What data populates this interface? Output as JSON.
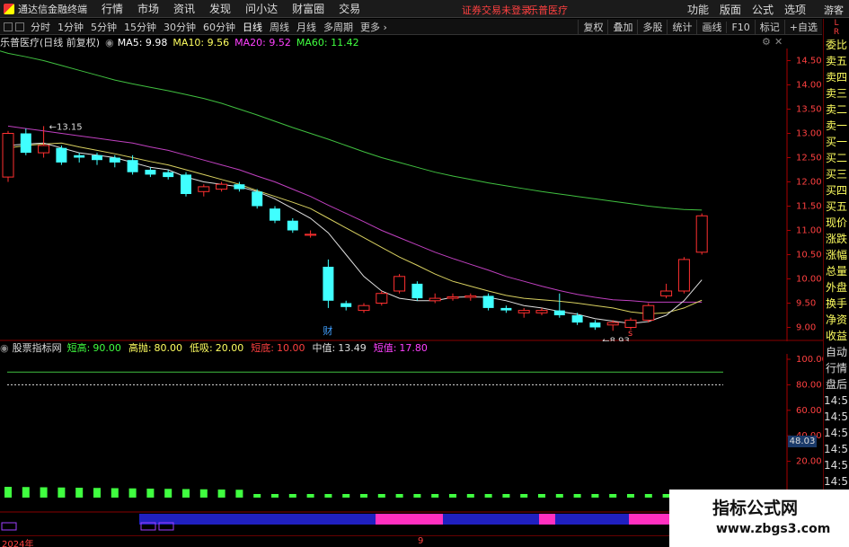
{
  "menubar": {
    "app_title": "通达信金融终端",
    "items": [
      "行情",
      "市场",
      "资讯",
      "发现",
      "问小达",
      "财富圈",
      "交易"
    ],
    "login_warning": "证券交易未登录",
    "stock_link": "乐普医疗",
    "right_items": [
      "功能",
      "版面",
      "公式",
      "选项"
    ],
    "guest": "游客"
  },
  "toolbar": {
    "periods": [
      "分时",
      "1分钟",
      "5分钟",
      "15分钟",
      "30分钟",
      "60分钟",
      "日线",
      "周线",
      "月线",
      "多周期",
      "更多"
    ],
    "active": "日线",
    "right_buttons": [
      "复权",
      "叠加",
      "多股",
      "统计",
      "画线",
      "F10",
      "标记",
      "+自选"
    ]
  },
  "header": {
    "stock_name": "乐普医疗(日线 前复权)",
    "ma5": "MA5: 9.98",
    "ma10": "MA10: 9.56",
    "ma20": "MA20: 9.52",
    "ma60": "MA60: 11.42"
  },
  "right_column": {
    "top": "L\nR",
    "labels": [
      "委比",
      "卖五",
      "卖四",
      "卖三",
      "卖二",
      "卖一",
      "买一",
      "买二",
      "买三",
      "买四",
      "买五",
      "现价",
      "涨跌",
      "涨幅",
      "总量",
      "外盘",
      "换手",
      "净资",
      "收益",
      "自动",
      "行情",
      "盘后",
      "14:5(",
      "14:5(",
      "14:5(",
      "14:5(",
      "14:5(",
      "14:5(",
      "14:5(",
      "14:5("
    ]
  },
  "price_axis": {
    "ticks": [
      "14.50",
      "14.00",
      "13.50",
      "13.00",
      "12.50",
      "12.00",
      "11.50",
      "11.00",
      "10.50",
      "10.00",
      "9.50",
      "9.00"
    ]
  },
  "indicator": {
    "name": "股票指标网",
    "items": [
      {
        "label": "短高:",
        "value": "90.00",
        "color": "#40ff40"
      },
      {
        "label": "高抛:",
        "value": "80.00",
        "color": "#ffff60"
      },
      {
        "label": "低吸:",
        "value": "20.00",
        "color": "#ffff60"
      },
      {
        "label": "短底:",
        "value": "10.00",
        "color": "#ff4040"
      },
      {
        "label": "中值:",
        "value": "13.49",
        "color": "#dddddd"
      },
      {
        "label": "短值:",
        "value": "17.80",
        "color": "#ff40ff"
      }
    ],
    "axis_ticks": [
      "100.00",
      "80.00",
      "60.00",
      "40.00",
      "20.00"
    ],
    "current_value": "48.03"
  },
  "date_axis": {
    "labels": [
      "2024年",
      "9"
    ]
  },
  "annotations": {
    "high_label": "13.15",
    "low_label": "8.93",
    "fin_marker": "财",
    "s_marker": "s"
  },
  "watermark": {
    "line1": "指标公式网",
    "line2": "www.zbgs3.com"
  },
  "chart_data": {
    "type": "candlestick",
    "ylim": [
      8.75,
      14.75
    ],
    "candles": [
      {
        "o": 12.1,
        "c": 13.0,
        "h": 13.05,
        "l": 12.0
      },
      {
        "o": 13.0,
        "c": 12.6,
        "h": 13.1,
        "l": 12.55
      },
      {
        "o": 12.6,
        "c": 12.75,
        "h": 13.15,
        "l": 12.5
      },
      {
        "o": 12.7,
        "c": 12.4,
        "h": 12.75,
        "l": 12.35
      },
      {
        "o": 12.55,
        "c": 12.5,
        "h": 12.6,
        "l": 12.4
      },
      {
        "o": 12.55,
        "c": 12.45,
        "h": 12.6,
        "l": 12.35
      },
      {
        "o": 12.5,
        "c": 12.4,
        "h": 12.55,
        "l": 12.3
      },
      {
        "o": 12.45,
        "c": 12.2,
        "h": 12.55,
        "l": 12.15
      },
      {
        "o": 12.25,
        "c": 12.15,
        "h": 12.3,
        "l": 12.1
      },
      {
        "o": 12.2,
        "c": 12.1,
        "h": 12.25,
        "l": 12.05
      },
      {
        "o": 12.15,
        "c": 11.75,
        "h": 12.2,
        "l": 11.7
      },
      {
        "o": 11.8,
        "c": 11.9,
        "h": 11.95,
        "l": 11.7
      },
      {
        "o": 11.85,
        "c": 11.95,
        "h": 12.0,
        "l": 11.8
      },
      {
        "o": 11.95,
        "c": 11.85,
        "h": 12.0,
        "l": 11.8
      },
      {
        "o": 11.8,
        "c": 11.5,
        "h": 11.85,
        "l": 11.45
      },
      {
        "o": 11.45,
        "c": 11.2,
        "h": 11.5,
        "l": 11.15
      },
      {
        "o": 11.2,
        "c": 11.0,
        "h": 11.25,
        "l": 10.95
      },
      {
        "o": 10.9,
        "c": 10.92,
        "h": 11.0,
        "l": 10.85
      },
      {
        "o": 10.25,
        "c": 9.55,
        "h": 10.4,
        "l": 9.4
      },
      {
        "o": 9.5,
        "c": 9.42,
        "h": 9.55,
        "l": 9.35
      },
      {
        "o": 9.35,
        "c": 9.45,
        "h": 9.5,
        "l": 9.3
      },
      {
        "o": 9.5,
        "c": 9.7,
        "h": 9.75,
        "l": 9.45
      },
      {
        "o": 9.75,
        "c": 10.05,
        "h": 10.1,
        "l": 9.7
      },
      {
        "o": 9.9,
        "c": 9.6,
        "h": 9.95,
        "l": 9.55
      },
      {
        "o": 9.55,
        "c": 9.6,
        "h": 9.7,
        "l": 9.5
      },
      {
        "o": 9.6,
        "c": 9.63,
        "h": 9.7,
        "l": 9.55
      },
      {
        "o": 9.62,
        "c": 9.65,
        "h": 9.7,
        "l": 9.55
      },
      {
        "o": 9.65,
        "c": 9.4,
        "h": 9.7,
        "l": 9.35
      },
      {
        "o": 9.4,
        "c": 9.35,
        "h": 9.45,
        "l": 9.3
      },
      {
        "o": 9.3,
        "c": 9.35,
        "h": 9.4,
        "l": 9.2
      },
      {
        "o": 9.3,
        "c": 9.35,
        "h": 9.4,
        "l": 9.25
      },
      {
        "o": 9.35,
        "c": 9.25,
        "h": 9.7,
        "l": 9.2
      },
      {
        "o": 9.25,
        "c": 9.1,
        "h": 9.3,
        "l": 9.05
      },
      {
        "o": 9.1,
        "c": 9.0,
        "h": 9.15,
        "l": 8.95
      },
      {
        "o": 9.05,
        "c": 9.1,
        "h": 9.15,
        "l": 8.93
      },
      {
        "o": 9.0,
        "c": 9.15,
        "h": 9.2,
        "l": 8.95
      },
      {
        "o": 9.15,
        "c": 9.45,
        "h": 9.5,
        "l": 9.1
      },
      {
        "o": 9.65,
        "c": 9.75,
        "h": 9.9,
        "l": 9.6
      },
      {
        "o": 9.75,
        "c": 10.4,
        "h": 10.45,
        "l": 9.7
      },
      {
        "o": 10.55,
        "c": 11.3,
        "h": 11.35,
        "l": 10.5
      }
    ],
    "ma60": [
      14.65,
      14.58,
      14.5,
      14.4,
      14.3,
      14.2,
      14.1,
      14.02,
      13.95,
      13.88,
      13.8,
      13.72,
      13.62,
      13.5,
      13.38,
      13.25,
      13.12,
      13.0,
      12.88,
      12.75,
      12.62,
      12.5,
      12.4,
      12.3,
      12.2,
      12.12,
      12.05,
      11.98,
      11.92,
      11.86,
      11.8,
      11.75,
      11.7,
      11.65,
      11.6,
      11.55,
      11.5,
      11.46,
      11.43,
      11.42
    ],
    "ma20": [
      13.15,
      13.1,
      13.05,
      13.0,
      12.95,
      12.9,
      12.85,
      12.8,
      12.72,
      12.65,
      12.55,
      12.45,
      12.35,
      12.25,
      12.12,
      12.0,
      11.85,
      11.7,
      11.52,
      11.35,
      11.18,
      11.0,
      10.85,
      10.7,
      10.55,
      10.42,
      10.3,
      10.18,
      10.05,
      9.95,
      9.85,
      9.76,
      9.68,
      9.62,
      9.57,
      9.55,
      9.52,
      9.52,
      9.52,
      9.52
    ],
    "ma10": [
      12.7,
      12.75,
      12.78,
      12.8,
      12.72,
      12.65,
      12.58,
      12.5,
      12.42,
      12.35,
      12.25,
      12.15,
      12.05,
      11.95,
      11.82,
      11.7,
      11.58,
      11.45,
      11.25,
      11.05,
      10.85,
      10.65,
      10.45,
      10.28,
      10.1,
      9.95,
      9.85,
      9.75,
      9.66,
      9.6,
      9.57,
      9.54,
      9.5,
      9.45,
      9.4,
      9.32,
      9.28,
      9.3,
      9.4,
      9.56
    ],
    "ma5": [
      12.75,
      12.78,
      12.8,
      12.7,
      12.6,
      12.55,
      12.5,
      12.4,
      12.3,
      12.25,
      12.1,
      12.0,
      11.95,
      11.9,
      11.8,
      11.65,
      11.45,
      11.25,
      10.95,
      10.5,
      10.05,
      9.75,
      9.6,
      9.55,
      9.55,
      9.62,
      9.63,
      9.62,
      9.55,
      9.45,
      9.4,
      9.33,
      9.27,
      9.18,
      9.13,
      9.08,
      9.12,
      9.25,
      9.55,
      9.98
    ],
    "indicator_lines": {
      "短高": 90,
      "高抛": 80,
      "低吸": 20,
      "短底": 10
    },
    "bottom_bars": [
      1,
      1,
      1,
      1,
      1,
      1,
      1,
      1,
      1,
      1,
      1,
      1,
      1,
      1,
      1,
      1,
      1,
      1,
      1,
      1,
      1,
      1,
      1,
      1,
      1,
      1,
      1,
      1,
      1,
      1,
      1,
      1,
      1,
      1,
      1,
      1,
      1,
      1,
      1,
      1
    ]
  }
}
